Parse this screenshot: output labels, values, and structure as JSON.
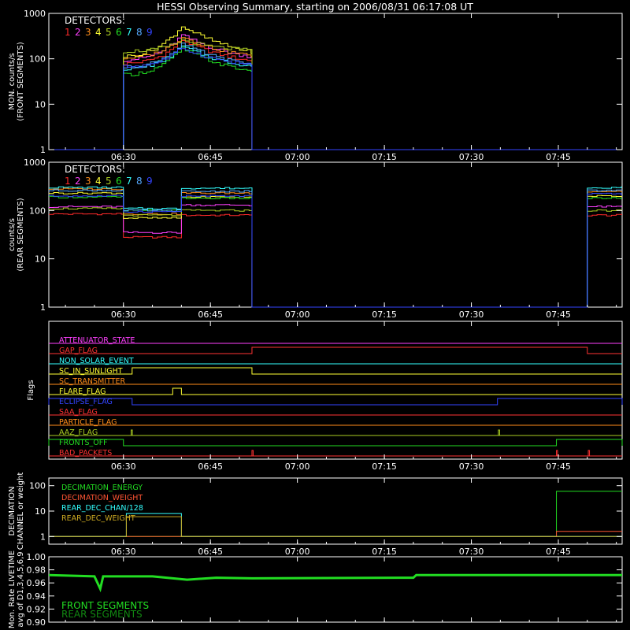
{
  "title": "HESSI Observing Summary, starting on 2006/08/31 06:17:08 UT",
  "colors": {
    "d1": "#ff2a2a",
    "d2": "#ff40ff",
    "d3": "#ff8c1a",
    "d4": "#ffff33",
    "d5": "#aacc22",
    "d6": "#22dd22",
    "d7": "#33ffff",
    "d8": "#55aaff",
    "d9": "#3344ff",
    "axis": "#ffffff"
  },
  "detectors_label": "DETECTORS:",
  "detector_numbers": [
    "1",
    "2",
    "3",
    "4",
    "5",
    "6",
    "7",
    "8",
    "9"
  ],
  "time_ticks": [
    "06:30",
    "06:45",
    "07:00",
    "07:15",
    "07:30",
    "07:45"
  ],
  "chart_data": [
    {
      "type": "line",
      "name": "front",
      "ylabel": [
        "MON. counts/s",
        "(FRONT SEGMENTS)"
      ],
      "ylog": true,
      "ylim": [
        1,
        1000
      ],
      "yticks": [
        "1",
        "10",
        "100",
        "1000"
      ],
      "xlim": [
        "06:17:08",
        "07:56:00"
      ],
      "on": [
        "06:30:00",
        "06:52:10"
      ],
      "peak": "06:40:00",
      "series": [
        {
          "det": 1,
          "base": 75,
          "peak": 260
        },
        {
          "det": 2,
          "base": 90,
          "peak": 330
        },
        {
          "det": 3,
          "base": 100,
          "peak": 310
        },
        {
          "det": 4,
          "base": 105,
          "peak": 520
        },
        {
          "det": 5,
          "base": 145,
          "peak": 260
        },
        {
          "det": 6,
          "base": 42,
          "peak": 170
        },
        {
          "det": 7,
          "base": 58,
          "peak": 190
        },
        {
          "det": 8,
          "base": 62,
          "peak": 215
        },
        {
          "det": 9,
          "base": 65,
          "peak": 175
        }
      ]
    },
    {
      "type": "line",
      "name": "rear",
      "ylabel": [
        "counts/s",
        "(REAR SEGMENTS)"
      ],
      "ylog": true,
      "ylim": [
        1,
        1000
      ],
      "yticks": [
        "1",
        "10",
        "100",
        "1000"
      ],
      "xlim": [
        "06:17:08",
        "07:56:00"
      ],
      "segments": [
        {
          "from": "06:17:08",
          "to": "06:30:00",
          "levels": [
            85,
            120,
            280,
            230,
            110,
            190,
            300,
            260,
            200
          ]
        },
        {
          "from": "06:30:00",
          "to": "06:40:00",
          "levels": [
            28,
            35,
            85,
            70,
            80,
            100,
            110,
            100,
            95
          ]
        },
        {
          "from": "06:40:00",
          "to": "06:52:10",
          "levels": [
            80,
            130,
            230,
            190,
            100,
            180,
            290,
            250,
            200
          ]
        },
        {
          "from": "07:50:00",
          "to": "07:56:00",
          "levels": [
            80,
            120,
            250,
            200,
            100,
            180,
            300,
            260,
            220
          ]
        }
      ]
    },
    {
      "type": "flags",
      "name": "flags",
      "ylabel": "Flags",
      "flags": [
        {
          "label": "ATTENUATOR_STATE",
          "color": "#ff40ff",
          "high": []
        },
        {
          "label": "GAP_FLAG",
          "color": "#ff3333",
          "high": [
            [
              "06:52:10",
              "07:50:00"
            ]
          ]
        },
        {
          "label": "NON_SOLAR_EVENT",
          "color": "#33ffff",
          "high": []
        },
        {
          "label": "SC_IN_SUNLIGHT",
          "color": "#ffff33",
          "high": [
            [
              "06:31:30",
              "06:52:10"
            ]
          ]
        },
        {
          "label": "SC_TRANSMITTER",
          "color": "#ff8c1a",
          "high": []
        },
        {
          "label": "FLARE_FLAG",
          "color": "#ffff33",
          "high": [
            [
              "06:38:30",
              "06:40:00"
            ]
          ]
        },
        {
          "label": "ECLIPSE_FLAG",
          "color": "#3344ff",
          "high": [
            [
              "06:17:08",
              "06:31:30"
            ],
            [
              "07:34:30",
              "07:56:00"
            ]
          ]
        },
        {
          "label": "SAA_FLAG",
          "color": "#ff3333",
          "high": []
        },
        {
          "label": "PARTICLE_FLAG",
          "color": "#ff8c1a",
          "high": []
        },
        {
          "label": "AAZ_FLAG",
          "color": "#aacc22",
          "spikes": [
            "06:31:20",
            "07:34:40"
          ]
        },
        {
          "label": "FRONTS_OFF",
          "color": "#22dd22",
          "high": [
            [
              "06:17:08",
              "06:30:00"
            ],
            [
              "07:44:40",
              "07:56:00"
            ]
          ]
        },
        {
          "label": "BAD_PACKETS",
          "color": "#ff3333",
          "spikes": [
            "06:52:10",
            "07:44:40",
            "07:50:10"
          ]
        }
      ]
    },
    {
      "type": "line",
      "name": "decimation",
      "ylabel": [
        "DECIMATION",
        "CHANNEL or weight"
      ],
      "ylog": true,
      "ylim": [
        0.5,
        200
      ],
      "yticks": [
        "1",
        "10",
        "100"
      ],
      "ytick_values": [
        1,
        10,
        100
      ],
      "xlim": [
        "06:17:08",
        "07:56:00"
      ],
      "series": [
        {
          "name": "DECIMATION_ENERGY",
          "color": "#22dd22",
          "steps": [
            [
              "06:17:08",
              0
            ],
            [
              "07:44:40",
              60
            ],
            [
              "07:56:00",
              60
            ]
          ]
        },
        {
          "name": "DECIMATION_WEIGHT",
          "color": "#ff5533",
          "steps": [
            [
              "06:17:08",
              0
            ],
            [
              "07:44:40",
              1.6
            ],
            [
              "07:56:00",
              1.6
            ]
          ]
        },
        {
          "name": "REAR_DEC_CHAN/128",
          "color": "#33ffff",
          "steps": [
            [
              "06:17:08",
              0
            ],
            [
              "06:30:30",
              8
            ],
            [
              "06:40:00",
              0
            ],
            [
              "07:56:00",
              0
            ]
          ]
        },
        {
          "name": "REAR_DEC_WEIGHT",
          "color": "#ccaa22",
          "steps": [
            [
              "06:17:08",
              0
            ],
            [
              "06:30:30",
              6
            ],
            [
              "06:40:00",
              0
            ],
            [
              "07:56:00",
              0
            ]
          ]
        }
      ]
    },
    {
      "type": "line",
      "name": "livetime",
      "ylabel": [
        "Mon. Rate LIVETIME",
        "avg of D1,3,4,5,6,9"
      ],
      "ylim": [
        0.9,
        1.0
      ],
      "yticks": [
        "0.90",
        "0.92",
        "0.94",
        "0.96",
        "0.98",
        "1.00"
      ],
      "ytick_values": [
        0.9,
        0.92,
        0.94,
        0.96,
        0.98,
        1.0
      ],
      "xlim": [
        "06:17:08",
        "07:56:00"
      ],
      "series": [
        {
          "name": "FRONT SEGMENTS",
          "color": "#22dd22",
          "points": [
            [
              "06:17:08",
              0.972
            ],
            [
              "06:25:00",
              0.97
            ],
            [
              "06:26:00",
              0.951
            ],
            [
              "06:26:30",
              0.97
            ],
            [
              "06:35:00",
              0.97
            ],
            [
              "06:41:00",
              0.965
            ],
            [
              "06:46:00",
              0.968
            ],
            [
              "06:52:10",
              0.967
            ],
            [
              "07:20:00",
              0.968
            ],
            [
              "07:20:30",
              0.972
            ],
            [
              "07:56:00",
              0.972
            ]
          ]
        },
        {
          "name": "REAR SEGMENTS",
          "color": "#118811",
          "points": []
        }
      ]
    }
  ]
}
